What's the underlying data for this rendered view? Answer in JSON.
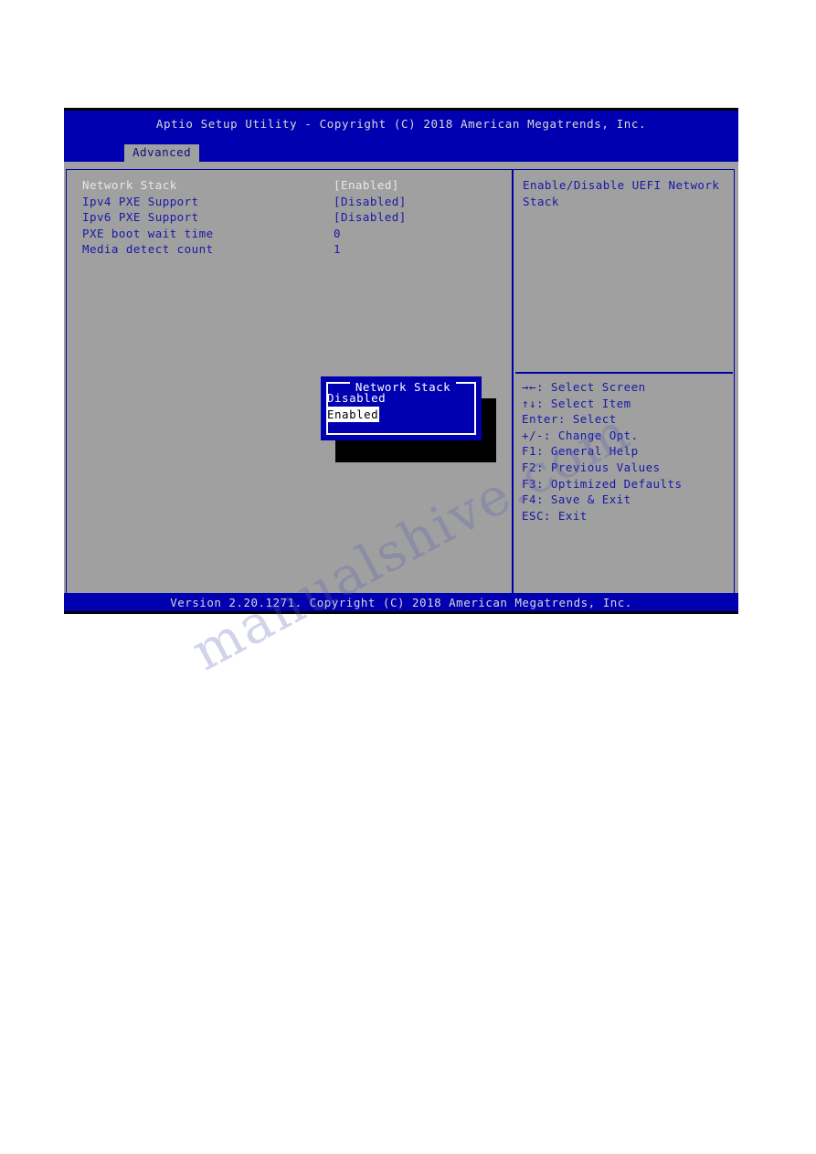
{
  "header": {
    "title": "Aptio Setup Utility - Copyright (C) 2018 American Megatrends, Inc.",
    "active_tab": "Advanced",
    "tabs": [
      "Advanced"
    ]
  },
  "main": {
    "settings": [
      {
        "label": "Network Stack",
        "value": "[Enabled]",
        "selected": true
      },
      {
        "label": "Ipv4 PXE Support",
        "value": "[Disabled]",
        "selected": false
      },
      {
        "label": "Ipv6 PXE Support",
        "value": "[Disabled]",
        "selected": false
      },
      {
        "label": "PXE boot wait time",
        "value": "0",
        "selected": false
      },
      {
        "label": "Media detect count",
        "value": "1",
        "selected": false
      }
    ]
  },
  "help": {
    "description": "Enable/Disable UEFI Network Stack",
    "keys": [
      "→←: Select Screen",
      "↑↓: Select Item",
      "Enter: Select",
      "+/-: Change Opt.",
      "F1: General Help",
      "F2: Previous Values",
      "F3: Optimized Defaults",
      "F4: Save & Exit",
      "ESC: Exit"
    ]
  },
  "popup": {
    "title": "Network Stack",
    "options": [
      {
        "label": "Disabled",
        "selected": false
      },
      {
        "label": "Enabled",
        "selected": true
      }
    ]
  },
  "footer": {
    "text": "Version 2.20.1271. Copyright (C) 2018 American Megatrends, Inc."
  },
  "watermark": {
    "text": "manualshive.com"
  },
  "colors": {
    "header_blue": "#0000b0",
    "panel_gray": "#a0a0a0",
    "text_blue": "#1818a8",
    "selected_white": "#e8e8e8",
    "popup_blue": "#0000b0",
    "shadow_black": "#000000"
  }
}
